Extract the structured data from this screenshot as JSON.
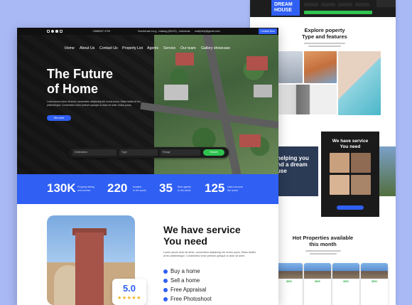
{
  "back_page": {
    "logo": "DREAM\nHOUSE",
    "explore_title": "Explore poperty\nType and features",
    "help_text": "helping you\nnd a dream\nuse",
    "service_box_title": "We have service\nYou need",
    "hot_title": "Hot Properties available\nthis month",
    "prices": [
      "$500",
      "$500",
      "$500",
      "$500"
    ]
  },
  "topbar": {
    "location": "Sumbersari no.g - malang (65122) - Indonesia",
    "phone": "+0888267 9709",
    "email": "realtyhelp@gmail.com",
    "contact_button": "Contact Now"
  },
  "nav": {
    "items": [
      "Home",
      "About Us",
      "Contact Us",
      "Property List",
      "Agents",
      "Service",
      "Our team",
      "Gallery showcase"
    ]
  },
  "hero": {
    "title": "The Future\nof Home",
    "description": "Lorem ipsum dolor sit amet, consectetur adipiscing elit, luctus purus. Etiam facilisi at leo pellentesque. Consectetur tortor pretium quisque ut dolor sit amet, luctus purus.",
    "button": "See more"
  },
  "search": {
    "destination": "Destination",
    "type": "Type",
    "range": "Range",
    "button": "Search"
  },
  "stats": [
    {
      "value": "130K",
      "label": "Property listing\nand service"
    },
    {
      "value": "220",
      "label": "location\nin the world"
    },
    {
      "value": "35",
      "label": "Best agents\nin the world"
    },
    {
      "value": "125",
      "label": "Users around\nthe world"
    }
  ],
  "service": {
    "title": "We have service\nYou need",
    "description": "Lorem ipsum dolor sit amet, consectetur adipiscing elit, luctus purus. Etiam facilisi at leo pellentesque. Consectetur tortor pretium quisque ut dolor sit amet.",
    "items": [
      "Buy a home",
      "Sell a home",
      "Free Appraisal",
      "Free Photoshoot"
    ],
    "rating": "5.0",
    "stars": "★★★★★"
  },
  "colors": {
    "accent": "#2f5ff3",
    "green": "#2fc24f",
    "dark": "#121212",
    "star": "#f4b41a"
  }
}
